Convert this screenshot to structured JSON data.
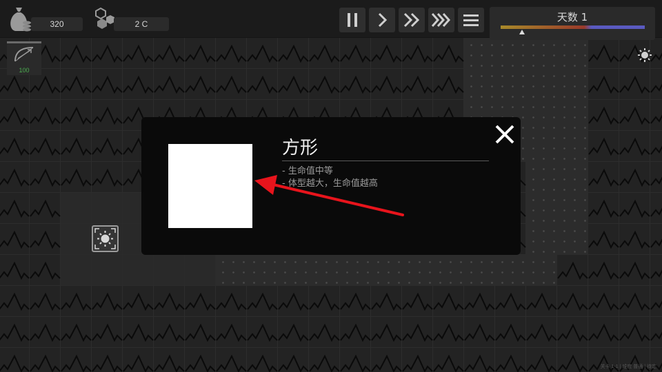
{
  "resources": {
    "gold": {
      "icon": "money-bag-icon",
      "value": "320"
    },
    "crystals": {
      "icon": "gems-icon",
      "value": "2 C"
    }
  },
  "controls": {
    "pause": "pause-icon",
    "play": "play-icon",
    "fast_forward": "fast-forward-icon",
    "fastest": "fastest-forward-icon",
    "menu": "menu-icon"
  },
  "day": {
    "label": "天数 1",
    "progress": 0.15,
    "colors": [
      "#a88a2a",
      "#9a3a2a",
      "#5a5ac0"
    ]
  },
  "tower_slot": {
    "icon": "bow-icon",
    "cost": "100",
    "cost_color": "#4caf50"
  },
  "settings": {
    "icon": "sun-gear-icon"
  },
  "base": {
    "icon": "base-sun-icon"
  },
  "dialog": {
    "title": "方形",
    "lines": [
      "- 生命值中等",
      "- 体型越大，生命值越高"
    ],
    "preview_color": "#ffffff",
    "close_icon": "close-icon"
  },
  "annotation": {
    "color": "#e8141c"
  },
  "version": "关卡 1-1 | 难度 普通 | 待定"
}
